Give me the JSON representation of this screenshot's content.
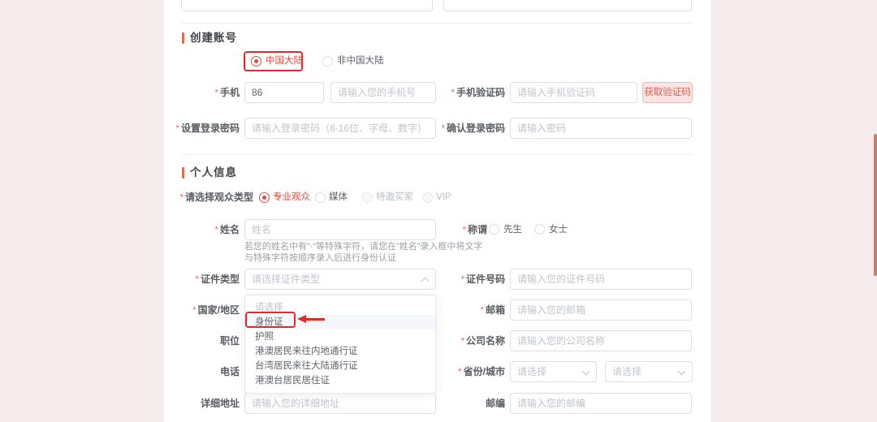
{
  "colors": {
    "page_pink_bg": "#f6ebec",
    "accent_orange": "#e0704d",
    "annotation_red": "#e12a2a",
    "radio_selected_red": "#e3493b",
    "get_code_button_bg": "#fbe4e3",
    "get_code_button_text": "#d95f51",
    "scrollbar_salmon": "#c67e6e"
  },
  "create_account": {
    "title": "创建账号",
    "region_options": [
      {
        "label": "中国大陆",
        "selected": true,
        "annotated": true
      },
      {
        "label": "非中国大陆",
        "selected": false
      }
    ],
    "phone_label": "手机",
    "phone_code_value": "86",
    "phone_placeholder": "请输入您的手机号",
    "sms_label": "手机验证码",
    "sms_placeholder": "请输入手机验证码",
    "get_code_button": "获取验证码",
    "password_label": "设置登录密码",
    "password_placeholder": "请输入登录密码（8-16位、字母、数字）",
    "confirm_label": "确认登录密码",
    "confirm_placeholder": "请输入密码"
  },
  "personal": {
    "title": "个人信息",
    "audience_label": "请选择观众类型",
    "audience_options": [
      {
        "label": "专业观众",
        "selected": true
      },
      {
        "label": "媒体",
        "selected": false
      },
      {
        "label": "特邀买家",
        "selected": false
      },
      {
        "label": "VIP",
        "selected": false
      }
    ],
    "name_label": "姓名",
    "name_placeholder": "姓名",
    "salutation_label": "称谓",
    "salutation_options": [
      {
        "label": "先生",
        "selected": false
      },
      {
        "label": "女士",
        "selected": false
      }
    ],
    "name_hint_line1": "若您的姓名中有“·”等特殊字符，请您在“姓名”录入框中将文字",
    "name_hint_line2": "与特殊字符按顺序录入后进行身份认证",
    "id_type_label": "证件类型",
    "id_type_placeholder": "请选择证件类型",
    "id_type_options": [
      "请选择",
      "身份证",
      "护照",
      "港澳居民来往内地通行证",
      "台湾居民来往大陆通行证",
      "港澳台居民居住证"
    ],
    "id_type_highlighted": "身份证",
    "id_number_label": "证件号码",
    "id_number_placeholder": "请输入您的证件号码",
    "country_label": "国家/地区",
    "email_label": "邮箱",
    "email_placeholder": "请输入您的邮箱",
    "position_label": "职位",
    "company_label": "公司名称",
    "company_placeholder": "请输入您的公司名称",
    "phone_label": "电话",
    "province_city_label": "省份/城市",
    "province_placeholder": "请选择",
    "city_placeholder": "请选择",
    "address_label": "详细地址",
    "address_placeholder": "请输入您的详细地址",
    "postcode_label": "邮编",
    "postcode_placeholder": "请输入您的邮编"
  }
}
